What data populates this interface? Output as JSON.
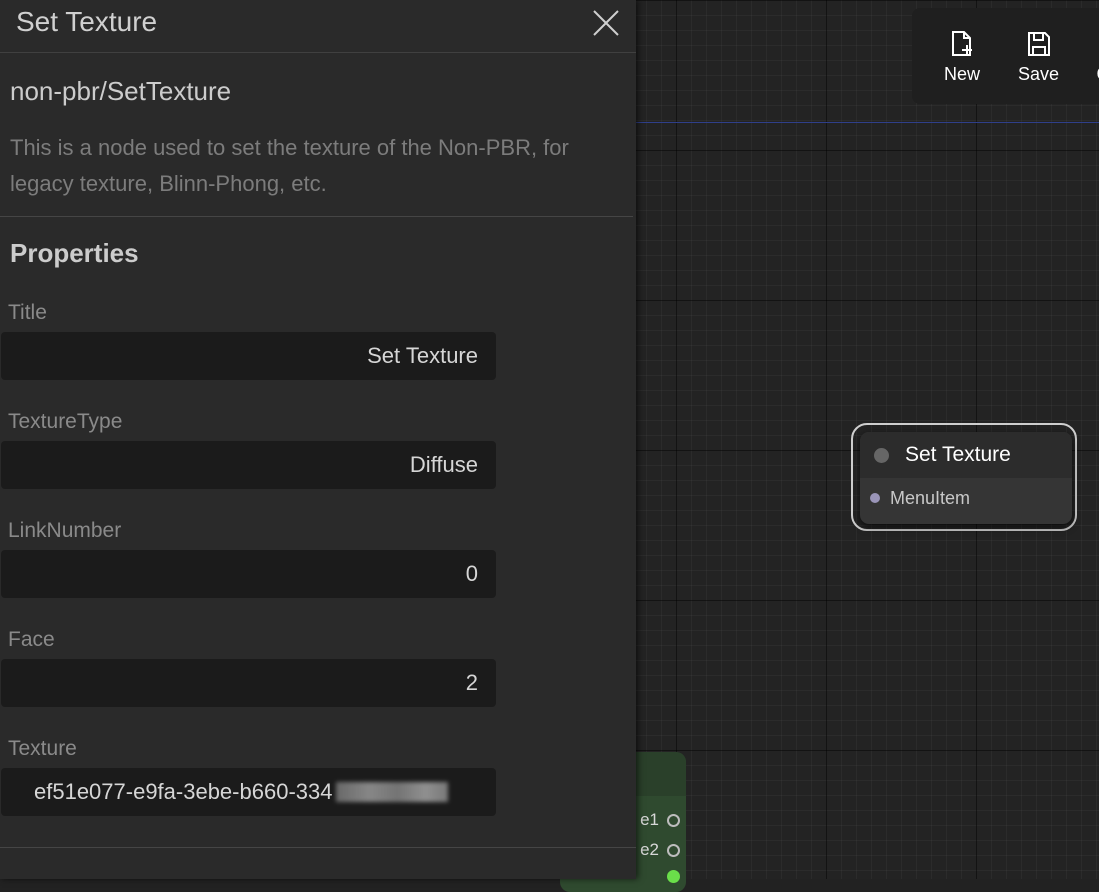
{
  "panel": {
    "title": "Set Texture",
    "node_type": "non-pbr/SetTexture",
    "description": "This is a node used to set the texture of the Non-PBR, for legacy texture, Blinn-Phong, etc.",
    "properties_heading": "Properties",
    "properties": [
      {
        "label": "Title",
        "value": "Set Texture"
      },
      {
        "label": "TextureType",
        "value": "Diffuse"
      },
      {
        "label": "LinkNumber",
        "value": "0"
      },
      {
        "label": "Face",
        "value": "2"
      },
      {
        "label": "Texture",
        "value": "ef51e077-e9fa-3ebe-b660-334"
      }
    ]
  },
  "toolbar": {
    "new_label": "New",
    "save_label": "Save",
    "more_label": "C"
  },
  "node": {
    "title": "Set Texture",
    "slot_label": "MenuItem"
  },
  "green_node": {
    "slot1": "e1",
    "slot2": "e2"
  },
  "colors": {
    "panel_bg": "#2a2a2a",
    "field_bg": "#1b1b1b",
    "canvas_bg": "#232323",
    "green_node": "#2f4a2f",
    "accent_line": "#2f3f8a"
  },
  "icons": [
    "close-icon",
    "new-file-icon",
    "save-icon"
  ]
}
